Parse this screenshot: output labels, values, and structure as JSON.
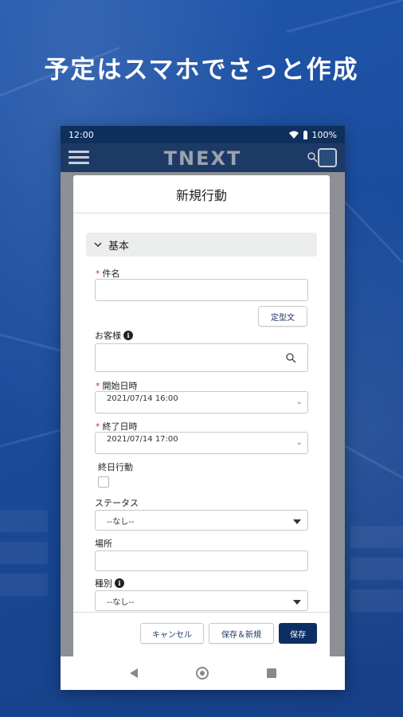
{
  "headline": "予定はスマホでさっと作成",
  "status_bar": {
    "time": "12:00",
    "battery": "100%"
  },
  "app_bar": {
    "logo": "TNEXT"
  },
  "modal": {
    "title": "新規行動",
    "section": {
      "label": "基本"
    },
    "fields": {
      "subject": {
        "label": "件名",
        "required": true,
        "value": ""
      },
      "template_button": "定型文",
      "customer": {
        "label": "お客様",
        "value": ""
      },
      "start": {
        "label": "開始日時",
        "required": true,
        "value": "2021/07/14 16:00"
      },
      "end": {
        "label": "終了日時",
        "required": true,
        "value": "2021/07/14 17:00"
      },
      "all_day": {
        "label": "終日行動",
        "checked": false
      },
      "status": {
        "label": "ステータス",
        "value": "--なし--"
      },
      "location": {
        "label": "場所",
        "value": ""
      },
      "type": {
        "label": "種別",
        "value": "--なし--"
      }
    },
    "footer": {
      "cancel": "キャンセル",
      "save_new": "保存＆新規",
      "save": "保存"
    }
  },
  "colors": {
    "primary": "#0d2e63",
    "required": "#c23934",
    "background": "#1b4fa0"
  },
  "icons": [
    "hamburger-icon",
    "search-icon",
    "chevron-down-icon",
    "info-icon",
    "wifi-icon",
    "battery-icon",
    "back-icon",
    "home-icon",
    "recent-apps-icon"
  ]
}
